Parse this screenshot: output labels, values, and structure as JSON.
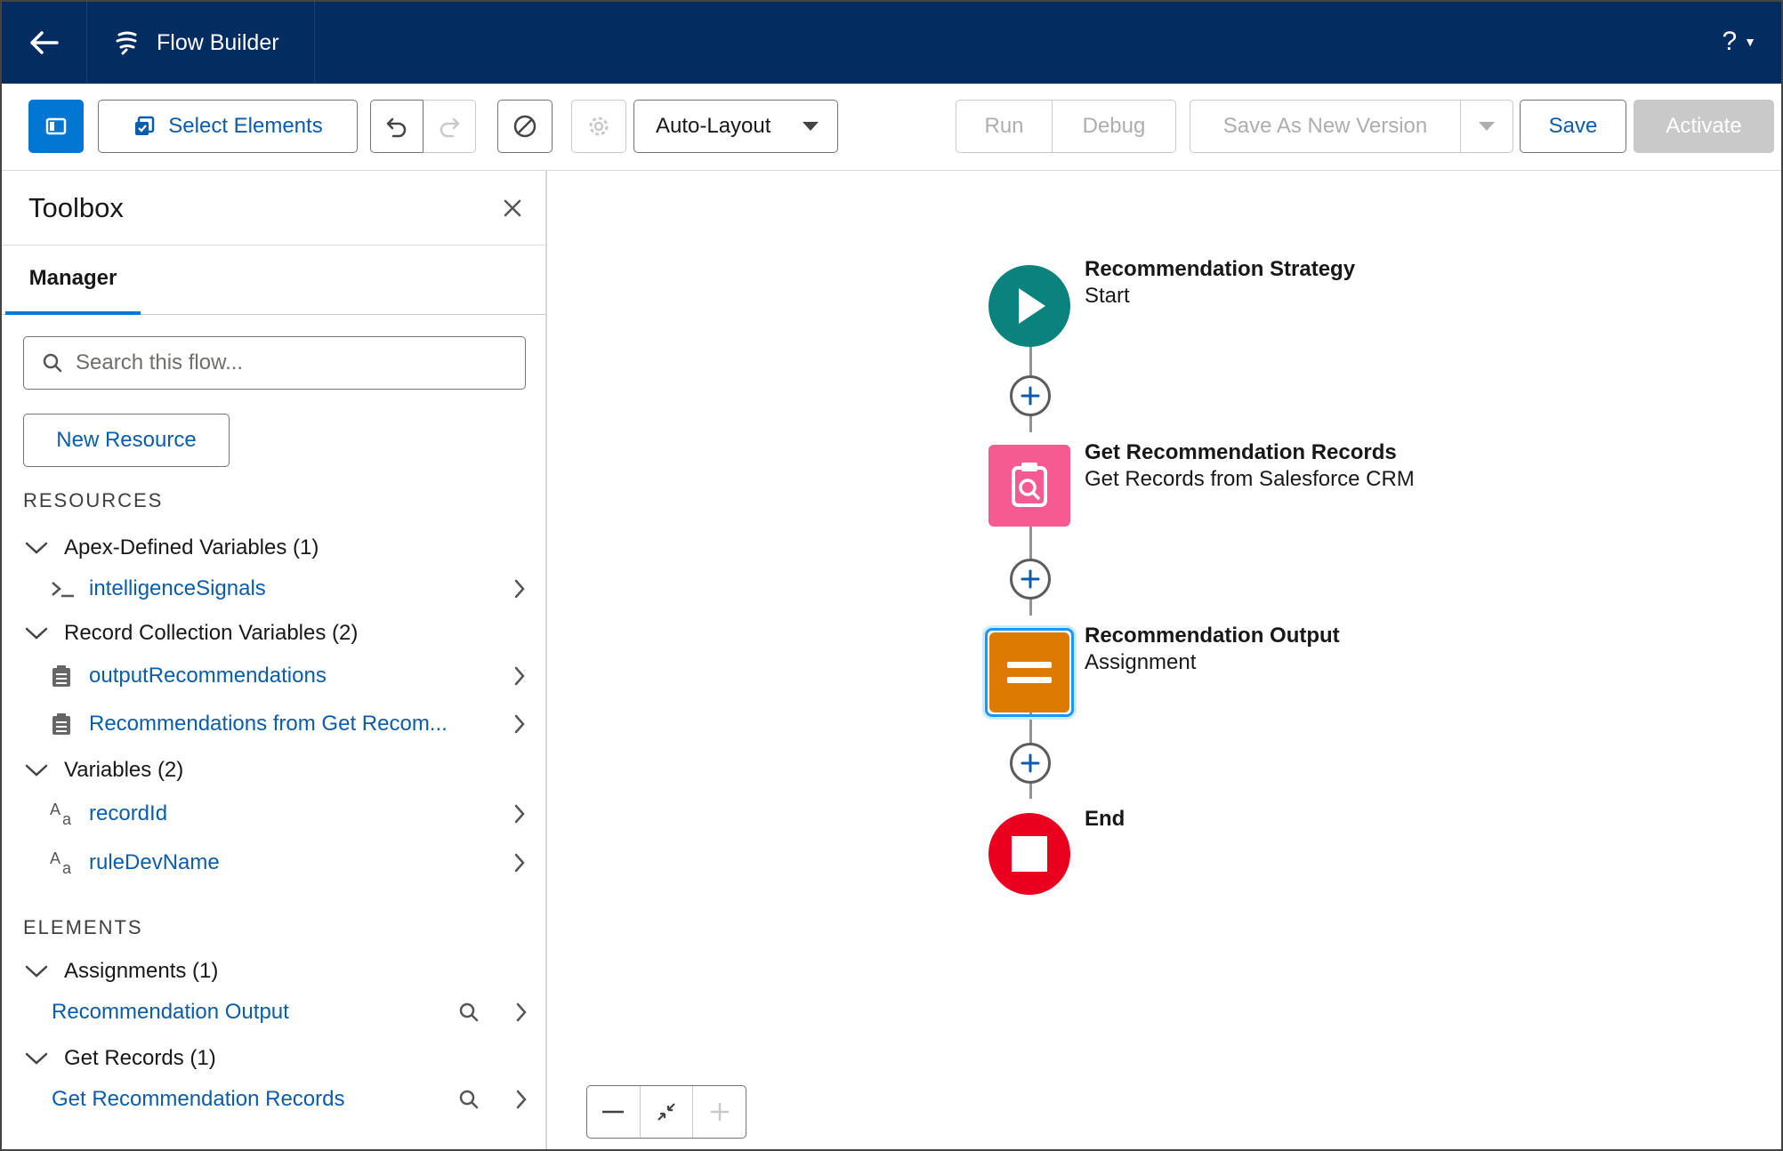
{
  "header": {
    "app_title": "Flow Builder",
    "help_label": "?"
  },
  "toolbar": {
    "select_elements": "Select Elements",
    "layout_mode": "Auto-Layout",
    "run": "Run",
    "debug": "Debug",
    "save_as_new_version": "Save As New Version",
    "save": "Save",
    "activate": "Activate"
  },
  "sidebar": {
    "title": "Toolbox",
    "tab": "Manager",
    "search_placeholder": "Search this flow...",
    "new_resource": "New Resource",
    "resources_heading": "RESOURCES",
    "resource_groups": [
      {
        "label": "Apex-Defined Variables (1)",
        "items": [
          {
            "label": "intelligenceSignals",
            "icon": "apex-icon"
          }
        ]
      },
      {
        "label": "Record Collection Variables (2)",
        "items": [
          {
            "label": "outputRecommendations",
            "icon": "record-collection-icon"
          },
          {
            "label": "Recommendations from Get Recom...",
            "icon": "record-collection-icon"
          }
        ]
      },
      {
        "label": "Variables (2)",
        "items": [
          {
            "label": "recordId",
            "icon": "text-variable-icon"
          },
          {
            "label": "ruleDevName",
            "icon": "text-variable-icon"
          }
        ]
      }
    ],
    "elements_heading": "ELEMENTS",
    "element_groups": [
      {
        "label": "Assignments (1)",
        "items": [
          {
            "label": "Recommendation Output"
          }
        ]
      },
      {
        "label": "Get Records (1)",
        "items": [
          {
            "label": "Get Recommendation Records"
          }
        ]
      }
    ]
  },
  "canvas": {
    "nodes": [
      {
        "title": "Recommendation Strategy",
        "subtitle": "Start",
        "color": "#0b827c"
      },
      {
        "title": "Get Recommendation Records",
        "subtitle": "Get Records from Salesforce CRM",
        "color": "#f55b91"
      },
      {
        "title": "Recommendation Output",
        "subtitle": "Assignment",
        "color": "#dd7a01"
      },
      {
        "title": "End",
        "subtitle": "",
        "color": "#ea001e"
      }
    ]
  }
}
